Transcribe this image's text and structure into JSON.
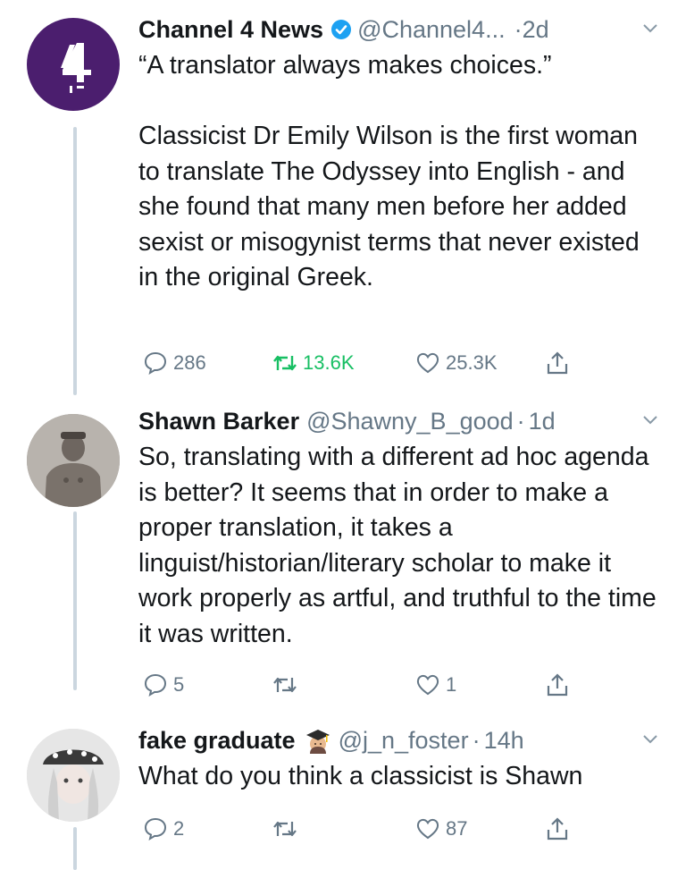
{
  "tweets": [
    {
      "name": "Channel 4 News",
      "verified": true,
      "handle": "@Channel4...",
      "dot": "·",
      "time": "2d",
      "text": "“A translator always makes choices.”\n\nClassicist Dr Emily Wilson is the first woman to translate The Odyssey into English - and she found that many men before her added sexist or misogynist terms that never existed in the original Greek.",
      "replies": "286",
      "retweets": "13.6K",
      "likes": "25.3K"
    },
    {
      "name": "Shawn Barker",
      "handle": "@Shawny_B_good",
      "dot": "·",
      "time": "1d",
      "text": "So, translating with a different ad hoc agenda is better? It seems that in order to make a proper translation, it takes a linguist/historian/literary scholar to make it work properly as artful, and truthful to the time it was written.",
      "replies": "5",
      "retweets": "",
      "likes": "1"
    },
    {
      "name": "fake graduate",
      "handle": "@j_n_foster",
      "dot": "·",
      "time": "14h",
      "text": "What do you think a classicist is Shawn",
      "replies": "2",
      "retweets": "",
      "likes": "87"
    }
  ],
  "colors": {
    "channel4_purple": "#4b1e6e",
    "retweet_green": "#17bf63",
    "verified_blue": "#1da1f2",
    "secondary_text": "#657786",
    "thread_line": "#cbd6df"
  },
  "icons": [
    "reply-icon",
    "retweet-icon",
    "like-icon",
    "share-icon",
    "verified-badge-icon",
    "chevron-down-icon",
    "graduate-emoji-icon"
  ]
}
